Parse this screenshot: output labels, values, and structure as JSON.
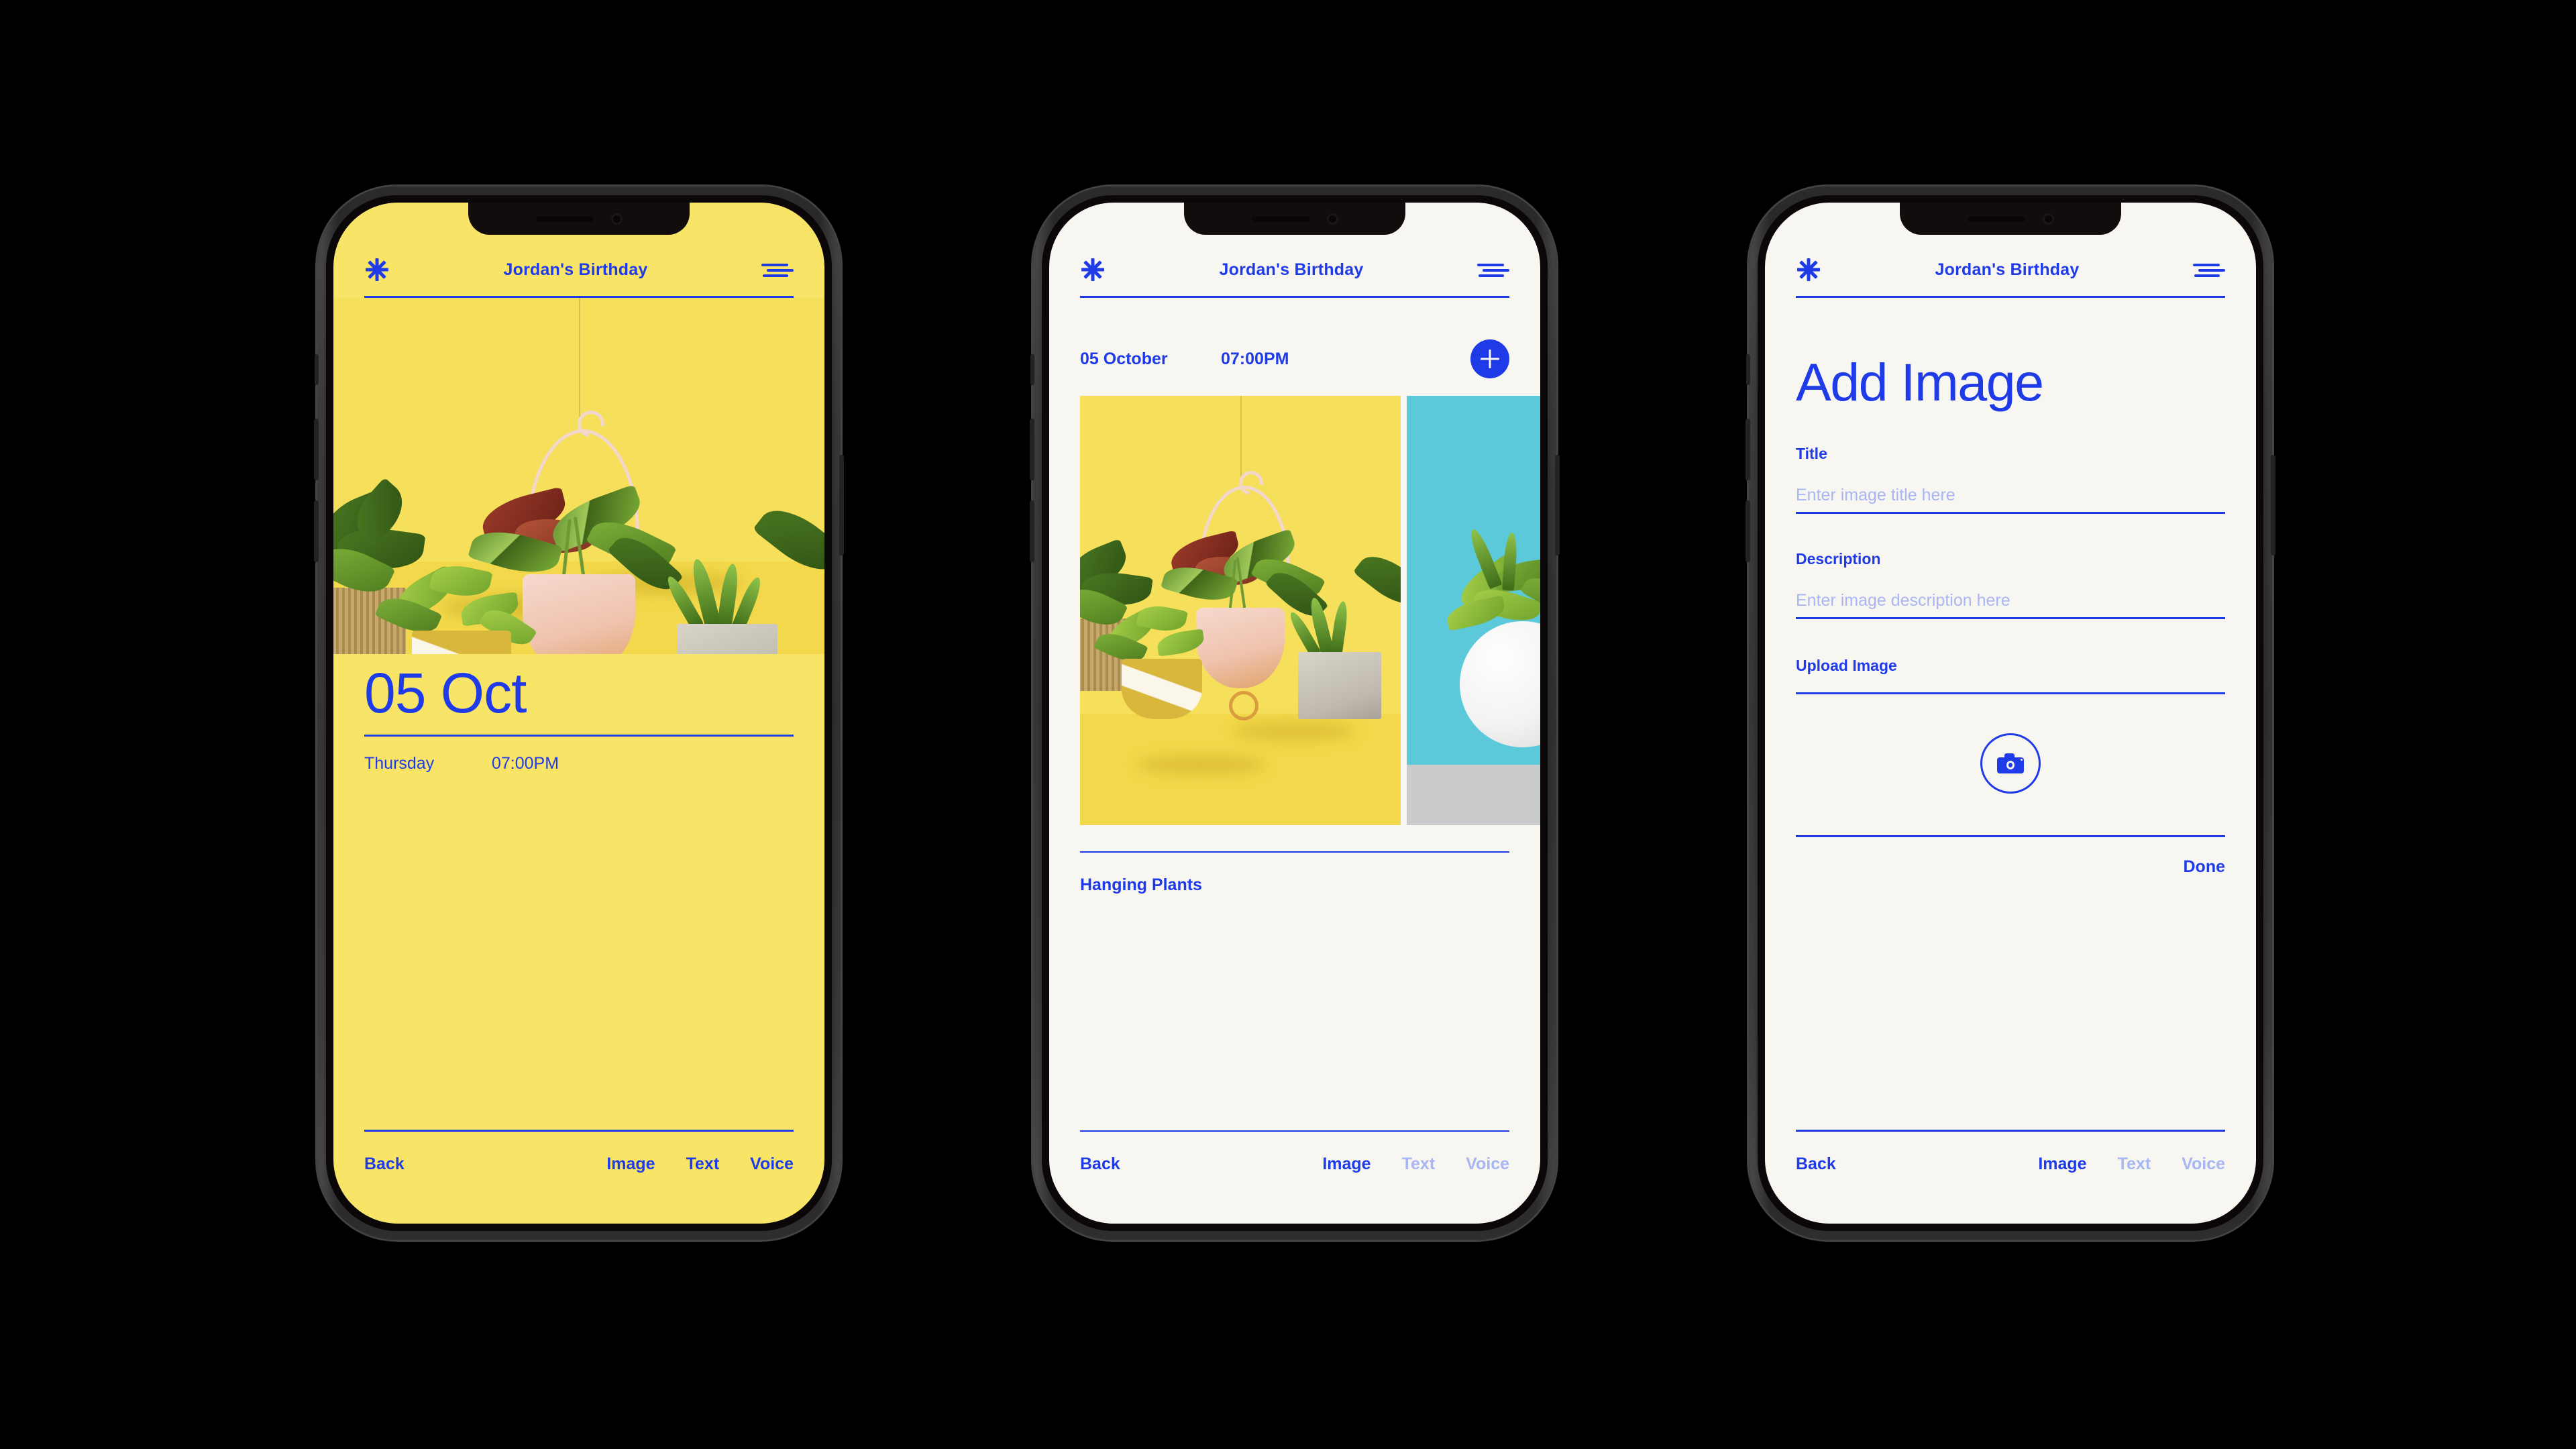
{
  "app": {
    "title": "Jordan's Birthday",
    "brand_color": "#1F3BE8",
    "muted_color": "#A9B6F4",
    "yellow": "#F8E567",
    "cream": "#F7F6F1"
  },
  "icons": {
    "star": "asterisk-icon",
    "menu": "hamburger-menu-icon",
    "plus": "plus-icon",
    "camera": "camera-icon"
  },
  "screen1": {
    "header_title": "Jordan's Birthday",
    "date_big": "05 Oct",
    "weekday": "Thursday",
    "time": "07:00PM",
    "nav": {
      "back": "Back",
      "image": "Image",
      "text": "Text",
      "voice": "Voice"
    }
  },
  "screen2": {
    "header_title": "Jordan's Birthday",
    "date": "05 October",
    "time": "07:00PM",
    "add_button": "+",
    "caption": "Hanging Plants",
    "nav": {
      "back": "Back",
      "image": "Image",
      "text": "Text",
      "voice": "Voice"
    }
  },
  "screen3": {
    "header_title": "Jordan's Birthday",
    "page_title": "Add Image",
    "title_label": "Title",
    "title_placeholder": "Enter image title here",
    "description_label": "Description",
    "description_placeholder": "Enter image description here",
    "upload_label": "Upload Image",
    "done": "Done",
    "nav": {
      "back": "Back",
      "image": "Image",
      "text": "Text",
      "voice": "Voice"
    }
  }
}
